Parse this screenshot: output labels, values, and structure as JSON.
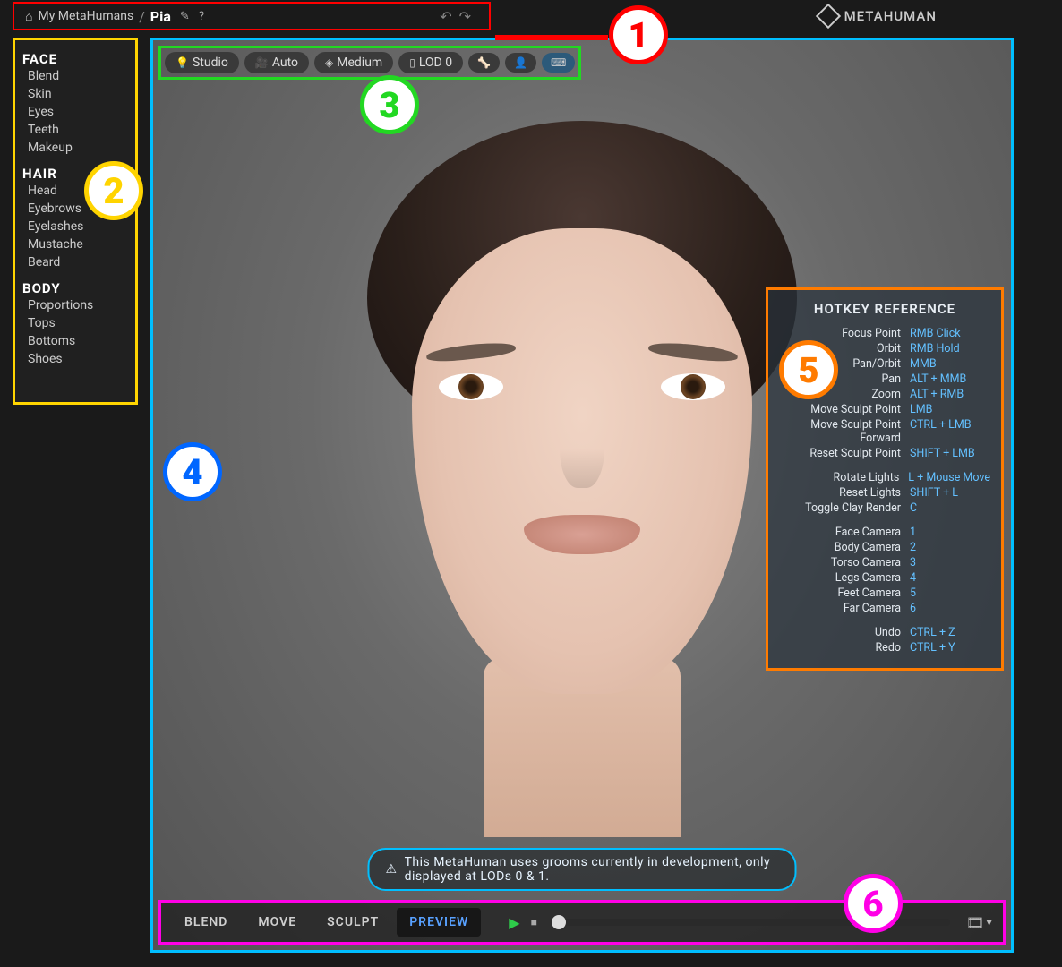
{
  "breadcrumb": {
    "root": "My MetaHumans",
    "sep": "/",
    "current": "Pia"
  },
  "brand": "METAHUMAN",
  "toolbar": {
    "lighting": "Studio",
    "camera": "Auto",
    "quality": "Medium",
    "lod": "LOD 0"
  },
  "sidebar": {
    "sections": [
      {
        "title": "FACE",
        "items": [
          "Blend",
          "Skin",
          "Eyes",
          "Teeth",
          "Makeup"
        ]
      },
      {
        "title": "HAIR",
        "items": [
          "Head",
          "Eyebrows",
          "Eyelashes",
          "Mustache",
          "Beard"
        ]
      },
      {
        "title": "BODY",
        "items": [
          "Proportions",
          "Tops",
          "Bottoms",
          "Shoes"
        ]
      }
    ]
  },
  "hotkey": {
    "title": "HOTKEY REFERENCE",
    "groups": [
      [
        {
          "label": "Focus Point",
          "key": "RMB Click"
        },
        {
          "label": "Orbit",
          "key": "RMB Hold"
        },
        {
          "label": "Pan/Orbit",
          "key": "MMB"
        },
        {
          "label": "Pan",
          "key": "ALT + MMB"
        },
        {
          "label": "Zoom",
          "key": "ALT + RMB"
        },
        {
          "label": "Move Sculpt Point",
          "key": "LMB"
        },
        {
          "label": "Move Sculpt Point Forward",
          "key": "CTRL + LMB"
        },
        {
          "label": "Reset Sculpt Point",
          "key": "SHIFT + LMB"
        }
      ],
      [
        {
          "label": "Rotate Lights",
          "key": "L + Mouse Move"
        },
        {
          "label": "Reset Lights",
          "key": "SHIFT + L"
        },
        {
          "label": "Toggle Clay Render",
          "key": "C"
        }
      ],
      [
        {
          "label": "Face Camera",
          "key": "1"
        },
        {
          "label": "Body Camera",
          "key": "2"
        },
        {
          "label": "Torso Camera",
          "key": "3"
        },
        {
          "label": "Legs Camera",
          "key": "4"
        },
        {
          "label": "Feet Camera",
          "key": "5"
        },
        {
          "label": "Far Camera",
          "key": "6"
        }
      ],
      [
        {
          "label": "Undo",
          "key": "CTRL + Z"
        },
        {
          "label": "Redo",
          "key": "CTRL + Y"
        }
      ]
    ]
  },
  "warning": "This MetaHuman uses grooms currently in development, only displayed at LODs 0 & 1.",
  "bottom": {
    "modes": [
      "BLEND",
      "MOVE",
      "SCULPT",
      "PREVIEW"
    ],
    "active": "PREVIEW"
  },
  "callouts": [
    "1",
    "2",
    "3",
    "4",
    "5",
    "6"
  ]
}
